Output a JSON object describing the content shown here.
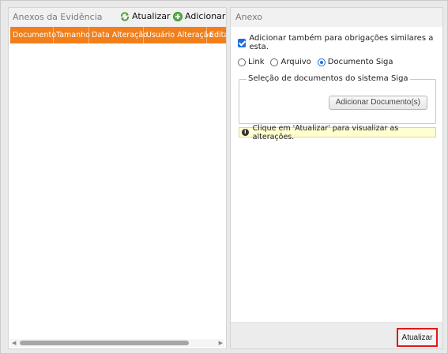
{
  "left_panel": {
    "title": "Anexos da Evidência",
    "atualizar_label": "Atualizar",
    "adicionar_label": "Adicionar",
    "columns": [
      "Documento",
      "Tamanho",
      "Data Alteração",
      "Usuário Alteração",
      "Editar"
    ]
  },
  "right_panel": {
    "title": "Anexo",
    "checkbox_label": "Adicionar também para obrigações similares a esta.",
    "checkbox_checked": true,
    "radio_options": [
      "Link",
      "Arquivo",
      "Documento Siga"
    ],
    "radio_selected": "Documento Siga",
    "fieldset_legend": "Seleção de documentos do sistema Siga",
    "add_document_label": "Adicionar Documento(s)",
    "info_message": "Clique em 'Atualizar' para visualizar as alterações.",
    "footer_button_label": "Atualizar"
  },
  "colors": {
    "grid_header": "#f07f1c",
    "highlight_border": "#e01919",
    "checkbox": "#1e6fd9",
    "info_background": "#ffffd2"
  }
}
